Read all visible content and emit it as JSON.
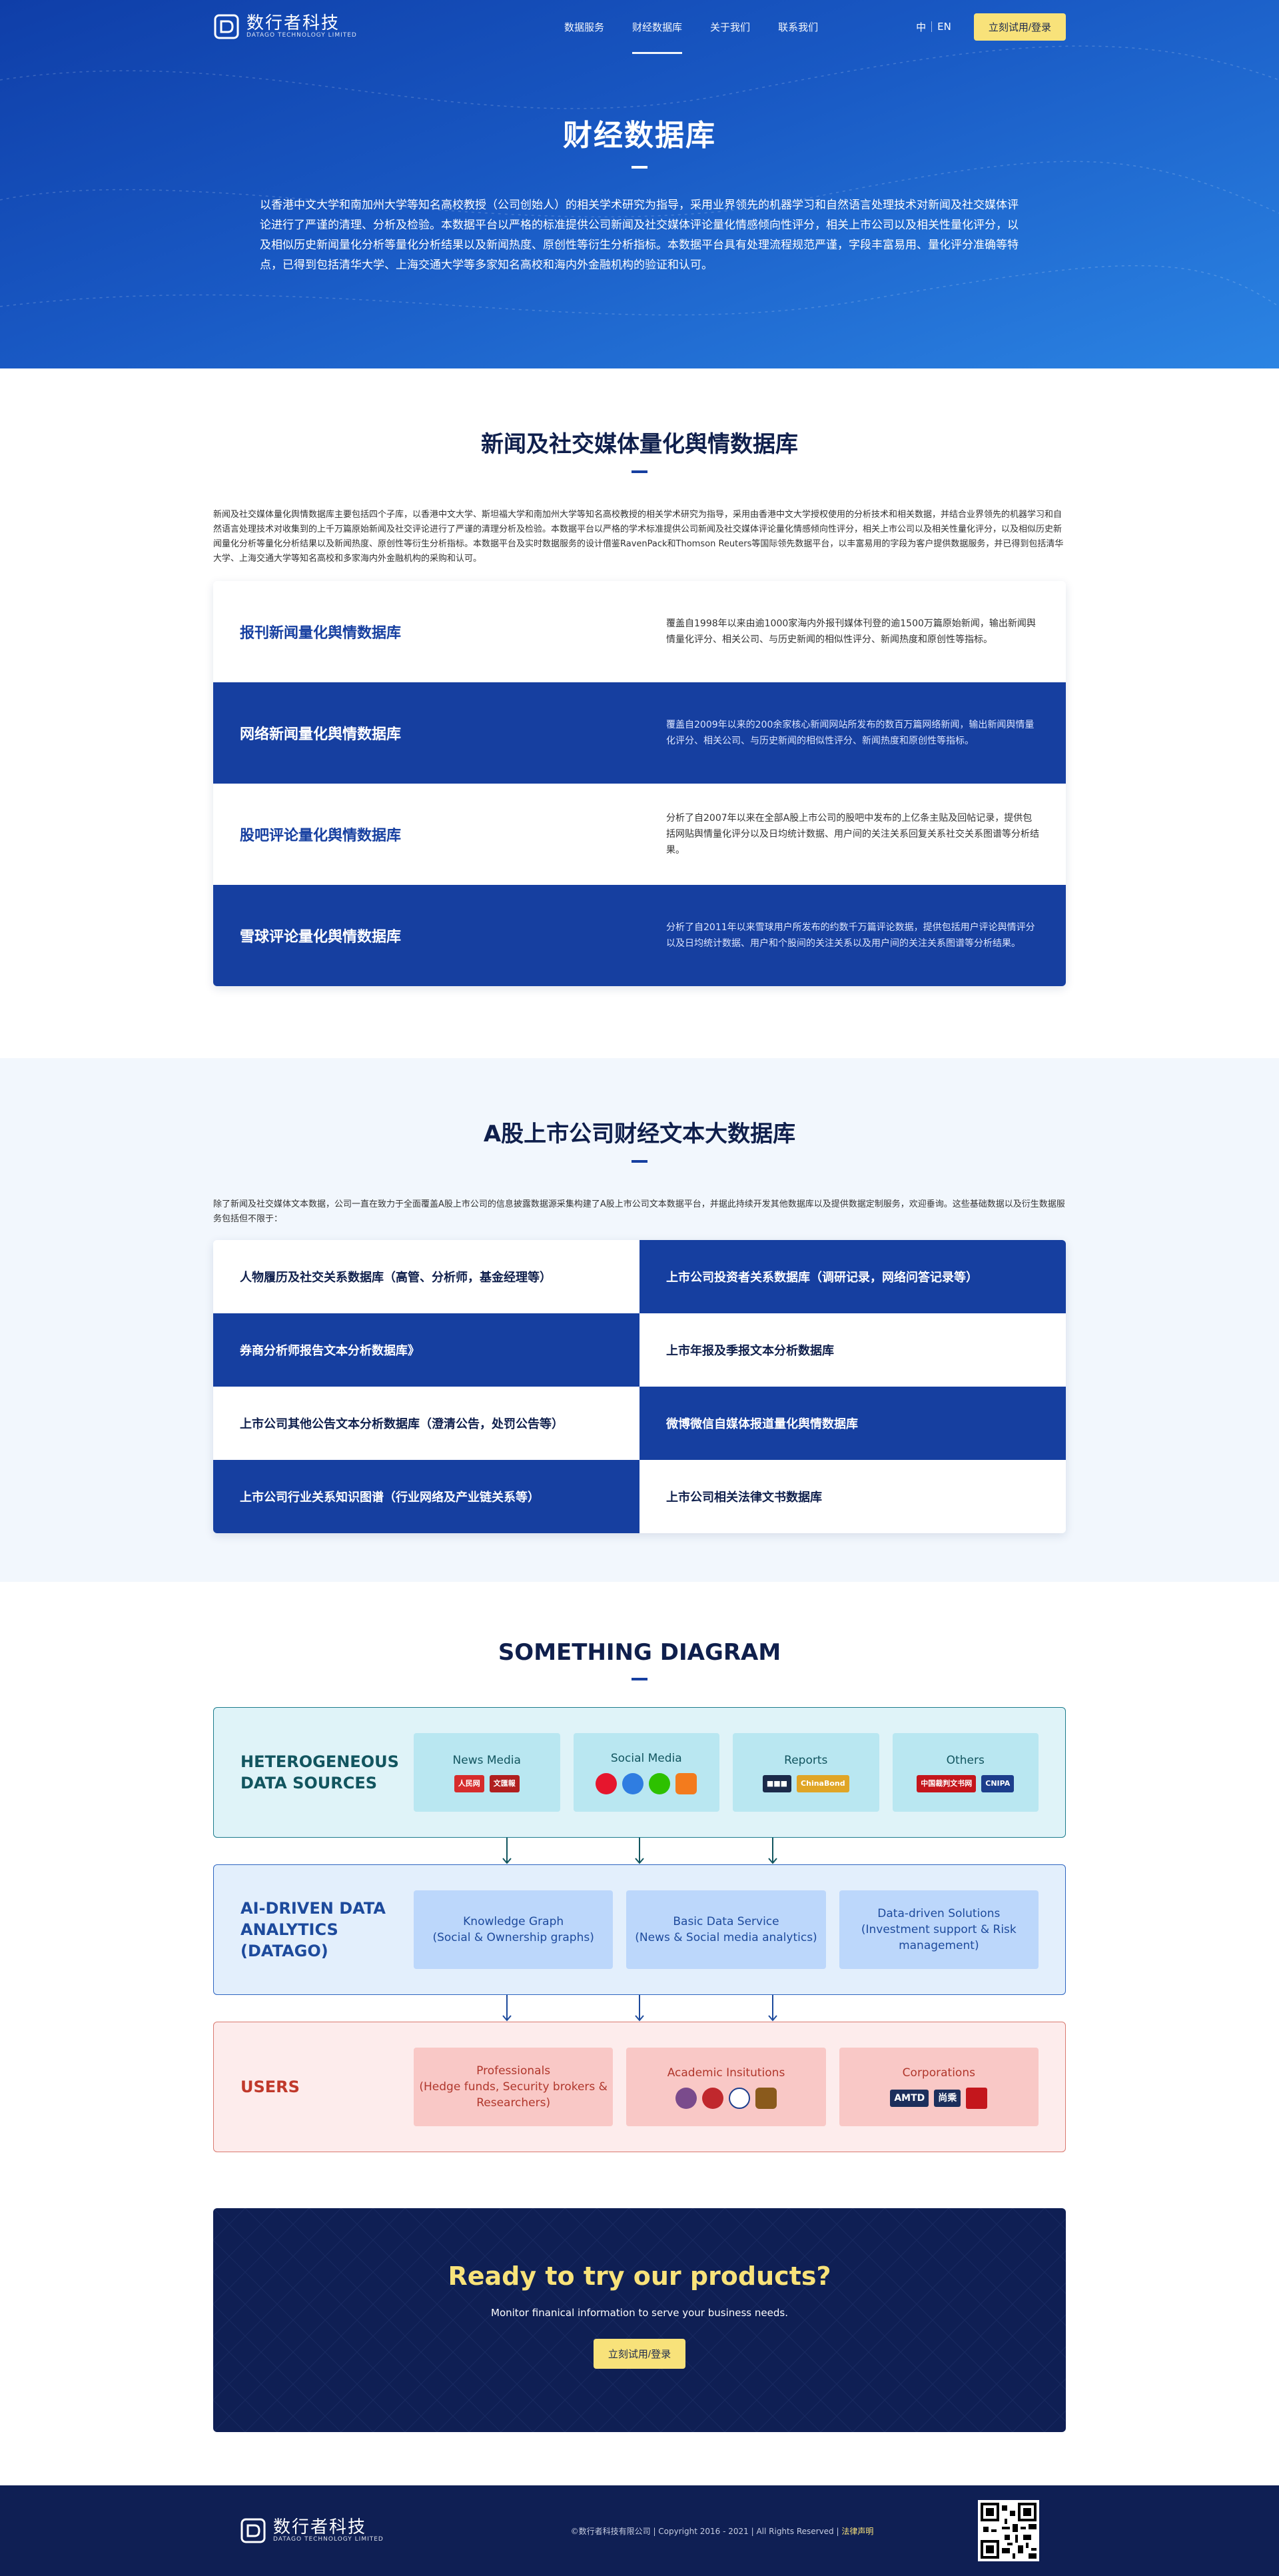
{
  "nav": {
    "logo_cn": "数行者科技",
    "logo_en": "DATAGO TECHNOLOGY LIMITED",
    "items": [
      {
        "label": "数据服务"
      },
      {
        "label": "财经数据库"
      },
      {
        "label": "关于我们"
      },
      {
        "label": "联系我们"
      }
    ],
    "active": "财经数据库",
    "lang_cn": "中",
    "lang_en": "EN",
    "login_label": "立刻试用/登录"
  },
  "hero": {
    "title": "财经数据库",
    "desc": "以香港中文大学和南加州大学等知名高校教授（公司创始人）的相关学术研究为指导，采用业界领先的机器学习和自然语言处理技术对新闻及社交媒体评论进行了严谨的清理、分析及检验。本数据平台以严格的标准提供公司新闻及社交媒体评论量化情感倾向性评分，相关上市公司以及相关性量化评分，以及相似历史新闻量化分析等量化分析结果以及新闻热度、原创性等衍生分析指标。本数据平台具有处理流程规范严谨，字段丰富易用、量化评分准确等特点，已得到包括清华大学、上海交通大学等多家知名高校和海内外金融机构的验证和认可。"
  },
  "news_section": {
    "title": "新闻及社交媒体量化舆情数据库",
    "desc": "新闻及社交媒体量化舆情数据库主要包括四个子库，以香港中文大学、斯坦福大学和南加州大学等知名高校教授的相关学术研究为指导，采用由香港中文大学授权使用的分析技术和相关数据，并结合业界领先的机器学习和自然语言处理技术对收集到的上千万篇原始新闻及社交评论进行了严谨的清理分析及检验。本数据平台以严格的学术标准提供公司新闻及社交媒体评论量化情感倾向性评分，相关上市公司以及相关性量化评分，以及相似历史新闻量化分析等量化分析结果以及新闻热度、原创性等衍生分析指标。本数据平台及实时数据服务的设计借鉴RavenPack和Thomson Reuters等国际领先数据平台，以丰富易用的字段为客户提供数据服务，并已得到包括清华大学、上海交通大学等知名高校和多家海内外金融机构的采购和认可。",
    "rows": [
      {
        "title": "报刊新闻量化舆情数据库",
        "desc": "覆盖自1998年以来由逾1000家海内外报刊媒体刊登的逾1500万篇原始新闻，输出新闻舆情量化评分、相关公司、与历史新闻的相似性评分、新闻热度和原创性等指标。"
      },
      {
        "title": "网络新闻量化舆情数据库",
        "desc": "覆盖自2009年以来的200余家核心新闻网站所发布的数百万篇网络新闻，输出新闻舆情量化评分、相关公司、与历史新闻的相似性评分、新闻热度和原创性等指标。"
      },
      {
        "title": "股吧评论量化舆情数据库",
        "desc": "分析了自2007年以来在全部A股上市公司的股吧中发布的上亿条主贴及回帖记录，提供包括网贴舆情量化评分以及日均统计数据、用户间的关注关系回复关系社交关系图谱等分析结果。"
      },
      {
        "title": "雪球评论量化舆情数据库",
        "desc": "分析了自2011年以来雪球用户所发布的约数千万篇评论数据，提供包括用户评论舆情评分以及日均统计数据、用户和个股间的关注关系以及用户间的关注关系图谱等分析结果。"
      }
    ]
  },
  "ashare_section": {
    "title": "A股上市公司财经文本大数据库",
    "desc": "除了新闻及社交媒体文本数据，公司一直在致力于全面覆盖A股上市公司的信息披露数据源采集构建了A股上市公司文本数据平台，并据此持续开发其他数据库以及提供数据定制服务，欢迎垂询。这些基础数据以及衍生数据服务包括但不限于：",
    "items": [
      "人物履历及社交关系数据库（高管、分析师，基金经理等）",
      "上市公司投资者关系数据库（调研记录，网络问答记录等）",
      "券商分析师报告文本分析数据库》",
      "上市年报及季报文本分析数据库",
      "上市公司其他公告文本分析数据库（澄清公告，处罚公告等）",
      "微博微信自媒体报道量化舆情数据库",
      "上市公司行业关系知识图谱（行业网络及产业链关系等）",
      "上市公司相关法律文书数据库"
    ]
  },
  "diagram": {
    "title": "SOMETHING DIAGRAM",
    "sources": {
      "label": "HETEROGENEOUS DATA SOURCES",
      "boxes": [
        "News Media",
        "Social Media",
        "Reports",
        "Others"
      ],
      "logos": {
        "news": [
          "人民网",
          "文匯報"
        ],
        "reports": [
          "ChinaBond"
        ],
        "others": [
          "中国裁判文书网",
          "CNIPA"
        ]
      }
    },
    "analytics": {
      "label": "AI-DRIVEN DATA ANALYTICS (DATAGO)",
      "boxes": [
        {
          "line1": "Knowledge Graph",
          "line2": "(Social & Ownership graphs)"
        },
        {
          "line1": "Basic Data Service",
          "line2": "(News & Social media analytics)"
        },
        {
          "line1": "Data-driven Solutions",
          "line2": "(Investment support & Risk management)"
        }
      ]
    },
    "users": {
      "label": "USERS",
      "boxes": [
        {
          "line1": "Professionals",
          "line2": "(Hedge funds, Security brokers & Researchers)"
        },
        {
          "line1": "Academic Insitutions",
          "line2": ""
        },
        {
          "line1": "Corporations",
          "line2": ""
        }
      ],
      "logos": {
        "corp": [
          "AMTD",
          "尚乘"
        ]
      }
    },
    "colors": {
      "sources": "#dff3f8",
      "analytics": "#e3effc",
      "users": "#fdecec"
    }
  },
  "cta": {
    "title": "Ready to try our products?",
    "subtitle": "Monitor finanical information to serve your business needs.",
    "button": "立刻试用/登录"
  },
  "footer": {
    "logo_cn": "数行者科技",
    "logo_en": "DATAGO TECHNOLOGY LIMITED",
    "copyright": "©数行者科技有限公司 | Copyright 2016 - 2021 | All Rights Reserved | ",
    "legal": "法律声明"
  }
}
